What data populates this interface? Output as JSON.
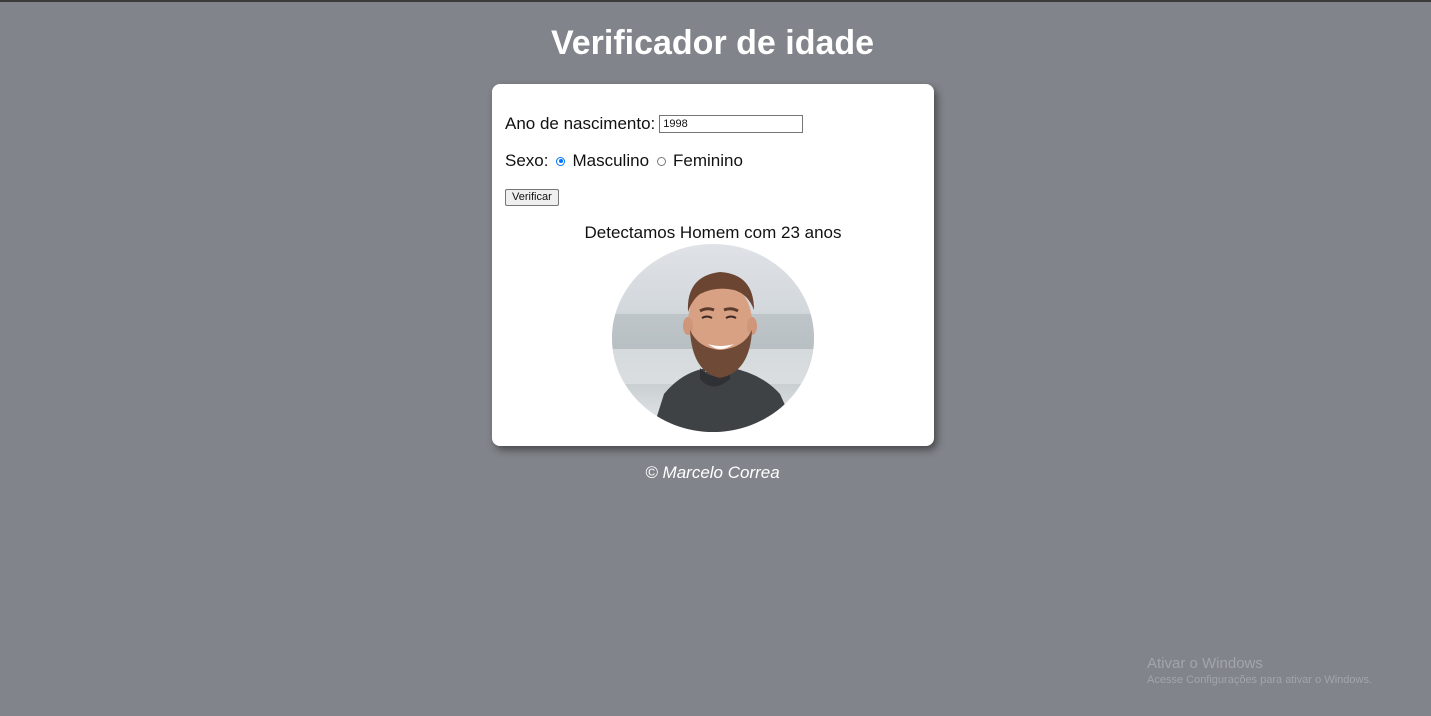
{
  "page": {
    "title": "Verificador de idade",
    "background_color": "#81848a"
  },
  "form": {
    "year_label": "Ano de nascimento:",
    "year_value": "1998",
    "sex_label": "Sexo:",
    "sex_options": [
      "Masculino",
      "Feminino"
    ],
    "sex_selected": "Masculino",
    "verify_label": "Verificar",
    "accent_color": "#0075ff"
  },
  "result": {
    "text": "Detectamos Homem com 23 anos",
    "image_icon": "man-with-beard-photo"
  },
  "footer": {
    "credit": "© Marcelo Correa"
  },
  "os_watermark": {
    "title": "Ativar o Windows",
    "subtitle": "Acesse Configurações para ativar o Windows."
  }
}
